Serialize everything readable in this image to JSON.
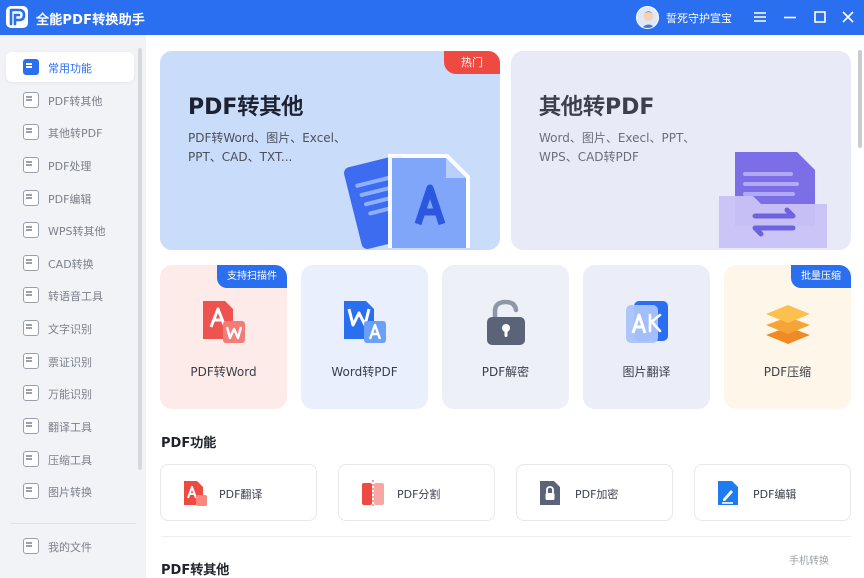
{
  "app": {
    "title": "全能PDF转换助手",
    "brand_color": "#2a6ff0",
    "username": "誓死守护宣宝"
  },
  "window_controls": [
    "menu-icon",
    "minimize-icon",
    "maximize-icon",
    "close-icon"
  ],
  "sidebar": {
    "items": [
      {
        "label": "常用功能",
        "active": true
      },
      {
        "label": "PDF转其他"
      },
      {
        "label": "其他转PDF"
      },
      {
        "label": "PDF处理"
      },
      {
        "label": "PDF编辑"
      },
      {
        "label": "WPS转其他"
      },
      {
        "label": "CAD转换"
      },
      {
        "label": "转语音工具"
      },
      {
        "label": "文字识别"
      },
      {
        "label": "票证识别"
      },
      {
        "label": "万能识别"
      },
      {
        "label": "翻译工具"
      },
      {
        "label": "压缩工具"
      },
      {
        "label": "图片转换"
      }
    ],
    "footer_label": "我的文件"
  },
  "hero": [
    {
      "title": "PDF转其他",
      "desc_line1": "PDF转Word、图片、Excel、",
      "desc_line2": "PPT、CAD、TXT...",
      "badge": "热门",
      "badge_color": "#ef4a42"
    },
    {
      "title": "其他转PDF",
      "desc_line1": "Word、图片、Execl、PPT、",
      "desc_line2": "WPS、CAD转PDF"
    }
  ],
  "tools": [
    {
      "label": "PDF转Word",
      "badge": "支持扫描件",
      "bg": "#fdebea"
    },
    {
      "label": "Word转PDF",
      "bg": "#e9effc"
    },
    {
      "label": "PDF解密",
      "bg": "#eef0f8"
    },
    {
      "label": "图片翻译",
      "bg": "#ebeef9"
    },
    {
      "label": "PDF压缩",
      "badge": "批量压缩",
      "bg": "#fef6e9"
    }
  ],
  "sections": {
    "pdf_functions": "PDF功能",
    "pdf_to_other": "PDF转其他"
  },
  "functions": [
    {
      "label": "PDF翻译",
      "icon": "pdf-translate-icon",
      "color": "#ef4a42"
    },
    {
      "label": "PDF分割",
      "icon": "pdf-split-icon",
      "color": "#ef4a42"
    },
    {
      "label": "PDF加密",
      "icon": "pdf-lock-icon",
      "color": "#5b6378"
    },
    {
      "label": "PDF编辑",
      "icon": "pdf-edit-icon",
      "color": "#1f7cf0"
    }
  ],
  "phone_link": "手机转换"
}
